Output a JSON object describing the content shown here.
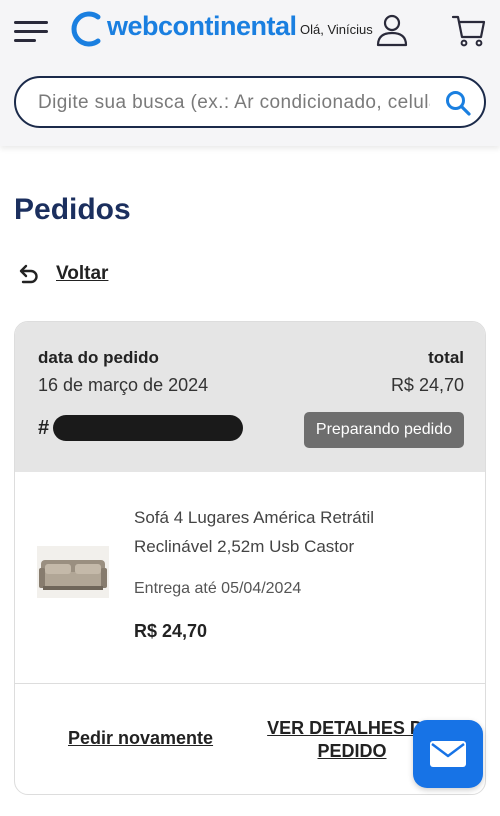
{
  "header": {
    "logo_text": "webcontinental",
    "greeting": "Olá, Vinícius",
    "icons": {
      "menu": "hamburger-menu-icon",
      "user": "user-icon",
      "cart": "cart-icon",
      "search": "search-icon"
    },
    "colors": {
      "brand": "#1a7fe0",
      "navy": "#1b2f5e"
    }
  },
  "search": {
    "placeholder": "Digite sua busca (ex.: Ar condicionado, celular)"
  },
  "page": {
    "title": "Pedidos",
    "back_label": "Voltar"
  },
  "order": {
    "date_label": "data do pedido",
    "date_value": "16 de março de 2024",
    "total_label": "total",
    "total_value": "R$ 24,70",
    "number_prefix": "#",
    "status": "Preparando pedido",
    "product": {
      "name": "Sofá 4 Lugares América Retrátil Reclinável 2,52m Usb Castor",
      "delivery": "Entrega até 05/04/2024",
      "price": "R$ 24,70"
    },
    "actions": {
      "reorder": "Pedir novamente",
      "details": "VER DETALHES DO PEDIDO"
    }
  },
  "fab": {
    "icon": "mail-icon",
    "color": "#1773e6"
  }
}
